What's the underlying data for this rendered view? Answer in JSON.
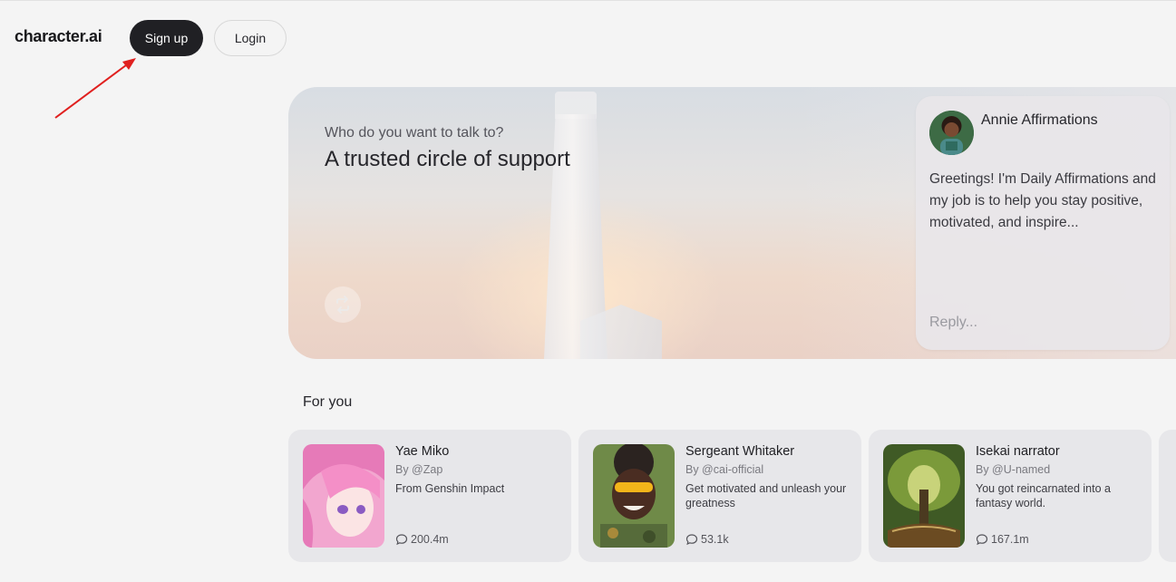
{
  "header": {
    "logo": "character.ai",
    "signup_label": "Sign up",
    "login_label": "Login"
  },
  "hero": {
    "question": "Who do you want to talk to?",
    "title": "A trusted circle of support",
    "refresh_icon": "refresh-icon",
    "chat": {
      "name": "Annie Affirmations",
      "message": "Greetings! I'm Daily Affirmations and my job is to help you stay positive, motivated, and inspire...",
      "reply_placeholder": "Reply..."
    }
  },
  "for_you": {
    "title": "For you",
    "cards": [
      {
        "name": "Yae Miko",
        "author": "By @Zap",
        "description": "From Genshin Impact",
        "interactions": "200.4m"
      },
      {
        "name": "Sergeant Whitaker",
        "author": "By @cai-official",
        "description": "Get motivated and unleash your greatness",
        "interactions": "53.1k"
      },
      {
        "name": "Isekai narrator",
        "author": "By @U-named",
        "description": "You got reincarnated into a fantasy world.",
        "interactions": "167.1m"
      }
    ]
  },
  "colors": {
    "signup_bg": "#202024",
    "page_bg": "#f4f4f4",
    "card_bg": "#e7e7ea",
    "annotation_arrow": "#e0201f"
  }
}
